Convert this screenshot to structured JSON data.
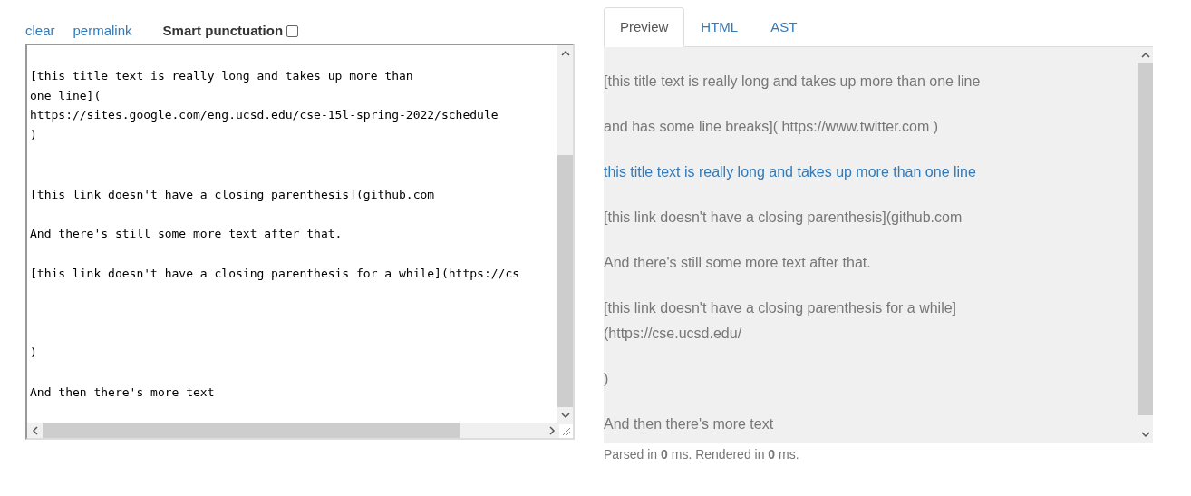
{
  "toolbar": {
    "links": [
      "clear",
      "permalink"
    ],
    "smart_punctuation": {
      "label": "Smart punctuation",
      "checked": false
    }
  },
  "editor": {
    "value": "\n[this title text is really long and takes up more than\none line](\nhttps://sites.google.com/eng.ucsd.edu/cse-15l-spring-2022/schedule\n)\n\n\n[this link doesn't have a closing parenthesis](github.com\n\nAnd there's still some more text after that.\n\n[this link doesn't have a closing parenthesis for a while](https://cs\n\n\n\n)\n\nAnd then there's more text"
  },
  "tabs": [
    {
      "label": "Preview",
      "selected": true
    },
    {
      "label": "HTML",
      "selected": false
    },
    {
      "label": "AST",
      "selected": false
    }
  ],
  "preview": {
    "paragraphs": [
      {
        "kind": "text",
        "lines": [
          "[this title text is really long and takes up more than one line"
        ]
      },
      {
        "kind": "text",
        "lines": [
          "and has some line breaks]( https://www.twitter.com )"
        ]
      },
      {
        "kind": "link",
        "lines": [
          "this title text is really long and takes up more than one line"
        ]
      },
      {
        "kind": "text",
        "lines": [
          "[this link doesn't have a closing parenthesis](github.com"
        ]
      },
      {
        "kind": "text",
        "lines": [
          "And there's still some more text after that."
        ]
      },
      {
        "kind": "text",
        "lines": [
          "[this link doesn't have a closing parenthesis for a while]",
          "(https://cse.ucsd.edu/"
        ]
      },
      {
        "kind": "text",
        "lines": [
          ")"
        ]
      },
      {
        "kind": "text",
        "lines": [
          "And then there's more text"
        ]
      }
    ]
  },
  "timing": "Parsed in **0** ms. Rendered in **0** ms."
}
